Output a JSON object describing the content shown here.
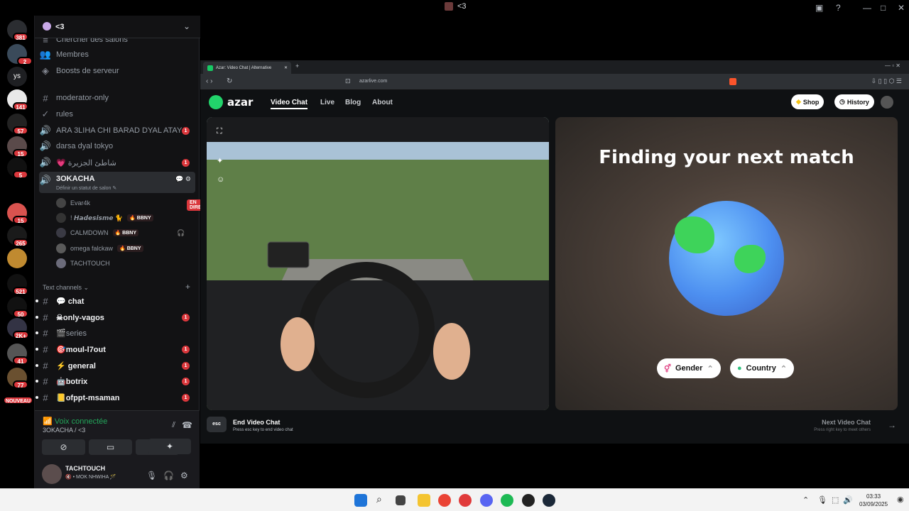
{
  "window": {
    "title": "<3",
    "controls": [
      "?",
      "—",
      "□",
      "✕"
    ]
  },
  "server_rail": [
    {
      "name": "discord-home",
      "badge": "381"
    },
    {
      "name": "server",
      "badge": "2"
    },
    {
      "name": "server-ys",
      "label": "ys",
      "badge": ""
    },
    {
      "name": "server",
      "badge": "141"
    },
    {
      "name": "server",
      "badge": "57"
    },
    {
      "name": "server",
      "badge": "15"
    },
    {
      "name": "server",
      "badge": "5"
    },
    {
      "name": "server",
      "badge": "15"
    },
    {
      "name": "server",
      "badge": "265"
    },
    {
      "name": "server",
      "badge": ""
    },
    {
      "name": "server",
      "badge": "521"
    },
    {
      "name": "server",
      "badge": "50"
    },
    {
      "name": "server",
      "badge": "2K+"
    },
    {
      "name": "server",
      "badge": "41"
    },
    {
      "name": "server",
      "badge": "77"
    },
    {
      "name": "server-new",
      "badge": "NOUVEAU"
    }
  ],
  "server": {
    "name": "<3"
  },
  "sidebar": {
    "top_items": [
      "Chercher des salons",
      "Membres",
      "Boosts de serveur"
    ],
    "channels": [
      {
        "icon": "#",
        "name": "moderator-only",
        "badge": ""
      },
      {
        "icon": "✓",
        "name": "rules",
        "badge": ""
      },
      {
        "icon": "🔊",
        "name": "ARA 3LIHA CHI BARAD DYAL ATAY",
        "badge": "1"
      },
      {
        "icon": "🔊",
        "name": "darsa dyal tokyo",
        "badge": ""
      },
      {
        "icon": "🔊",
        "name": "💗 شاطئ الجزيرة",
        "badge": "1"
      }
    ],
    "active_voice": {
      "name": "3OKACHA",
      "status": "Définir un statut de salon ✎"
    },
    "voice_users": [
      {
        "name": "Evar4k",
        "tag": "",
        "live": "EN DIRECT"
      },
      {
        "name": "! 𝙃𝙖𝙙𝙚𝙨𝙞𝙨𝙢𝙚 🐈",
        "tag": "🔥 BBNY",
        "live": ""
      },
      {
        "name": "CALMDOWN",
        "tag": "🔥 BBNY",
        "live": ""
      },
      {
        "name": "omega falckaw",
        "tag": "🔥 BBNY",
        "live": ""
      },
      {
        "name": "TACHTOUCH",
        "tag": "",
        "live": ""
      }
    ],
    "text_header": "Text channels",
    "text_channels": [
      {
        "name": "💬 chat",
        "badge": ""
      },
      {
        "name": "☠only-vagos",
        "badge": "1"
      },
      {
        "name": "🎬series",
        "badge": ""
      },
      {
        "name": "🎯moul-l7out",
        "badge": "1"
      },
      {
        "name": "⚡ general",
        "badge": "1"
      },
      {
        "name": "🤖botrix",
        "badge": "1"
      },
      {
        "name": "📒ofppt-msaman",
        "badge": "1"
      }
    ]
  },
  "voice_panel": {
    "connected": "Voix connectée",
    "location": "3OKACHA / <3",
    "buttons": [
      "camera-off",
      "screen-share",
      "activities",
      "soundboard"
    ]
  },
  "user_panel": {
    "name": "TACHTOUCH",
    "status": "🔇 • MOK NHWIHA 🪄"
  },
  "browser": {
    "tab_title": "Azar: Video Chat | Alternative",
    "url": "azarlive.com"
  },
  "azar": {
    "logo": "azar",
    "nav": [
      "Video Chat",
      "Live",
      "Blog",
      "About"
    ],
    "shop": "Shop",
    "history": "History",
    "finding": "Finding your next match",
    "gender": "Gender",
    "country": "Country",
    "esc_key": "esc",
    "end_title": "End Video Chat",
    "end_sub": "Press esc key to end video chat",
    "next_title": "Next Video Chat",
    "next_sub": "Press right key to meet others"
  },
  "taskbar": {
    "time": "03:33",
    "date": "03/09/2025"
  }
}
